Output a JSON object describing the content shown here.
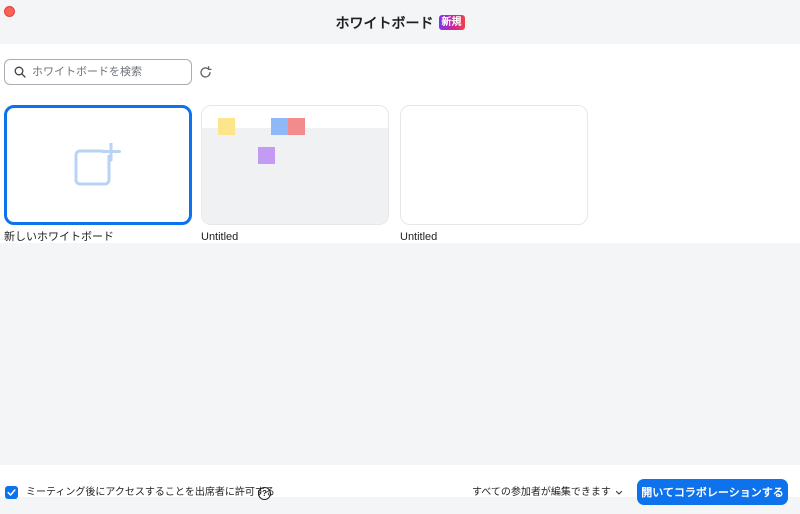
{
  "window": {
    "title": "ホワイトボード",
    "new_badge": "新規"
  },
  "search": {
    "placeholder": "ホワイトボードを検索",
    "value": ""
  },
  "boards": [
    {
      "label": "新しいホワイトボード",
      "kind": "new",
      "selected": true
    },
    {
      "label": "Untitled",
      "kind": "existing"
    },
    {
      "label": "Untitled",
      "kind": "existing"
    }
  ],
  "footer": {
    "allow_attendees_label": "ミーティング後にアクセスすることを出席者に許可する",
    "allow_attendees_checked": true,
    "permission_selected": "すべての参加者が編集できます",
    "primary_button": "開いてコラボレーションする"
  },
  "colors": {
    "accent": "#0e72ed",
    "titlebar_bg": "#f4f5f7",
    "close_dot": "#ff5f57"
  },
  "icons": {
    "search": "search-icon",
    "refresh": "refresh-icon",
    "new_board": "add-board-icon",
    "check": "check-icon",
    "help": "help-icon",
    "chevron": "chevron-down-icon"
  }
}
